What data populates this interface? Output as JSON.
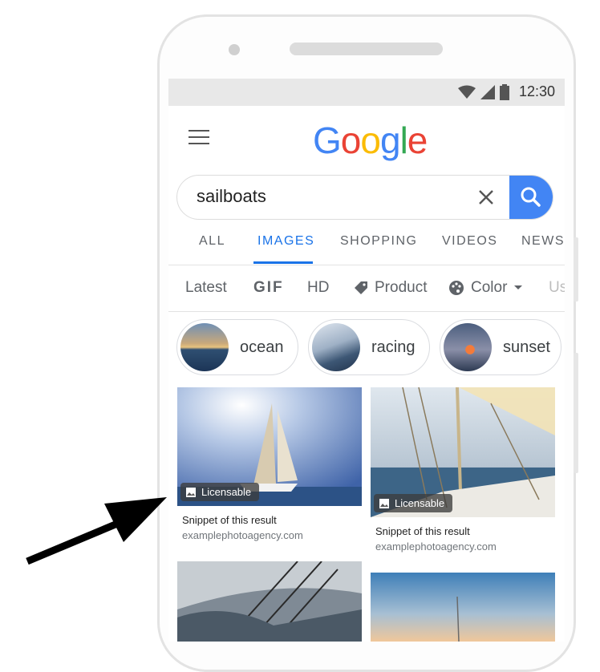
{
  "status": {
    "time": "12:30"
  },
  "logo": "Google",
  "search": {
    "query": "sailboats"
  },
  "tabs": [
    "ALL",
    "IMAGES",
    "SHOPPING",
    "VIDEOS",
    "NEWS"
  ],
  "filters": [
    "Latest",
    "GIF",
    "HD",
    "Product",
    "Color",
    "Us"
  ],
  "chips": [
    "ocean",
    "racing",
    "sunset"
  ],
  "results": [
    {
      "badge": "Licensable",
      "title": "Snippet of this result",
      "source": "examplephotoagency.com"
    },
    {
      "badge": "Licensable",
      "title": "Snippet of this result",
      "source": "examplephotoagency.com"
    }
  ],
  "colors": {
    "google_blue": "#4285F4",
    "google_red": "#EA4335",
    "google_yellow": "#FBBC05",
    "google_green": "#34A853",
    "active_tab": "#1A73E8"
  }
}
